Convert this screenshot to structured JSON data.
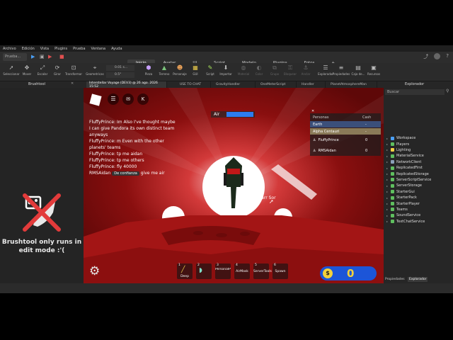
{
  "menu": [
    "Archivo",
    "Edición",
    "Vista",
    "Plugins",
    "Prueba",
    "Ventana",
    "Ayuda"
  ],
  "place_selector": "Prueba...",
  "ribbon_tabs": [
    {
      "label": "Inicio",
      "active": true
    },
    {
      "label": "Avatar",
      "active": false
    },
    {
      "label": "UI",
      "active": false
    },
    {
      "label": "Script",
      "active": false
    },
    {
      "label": "Modelo",
      "active": false
    },
    {
      "label": "Plugins",
      "active": false
    },
    {
      "label": "Fotos",
      "active": false
    },
    {
      "label": "+",
      "active": false
    }
  ],
  "tools": [
    {
      "label": "Seleccionar",
      "icon": "cursor-icon"
    },
    {
      "label": "Mover",
      "icon": "move-icon"
    },
    {
      "label": "Escalar",
      "icon": "scale-icon"
    },
    {
      "label": "Girar",
      "icon": "rotate-icon"
    },
    {
      "label": "Transformar",
      "icon": "transform-icon"
    },
    {
      "label": "Geometricas",
      "icon": "geometry-icon"
    },
    {
      "label": "Pieza",
      "icon": "part-icon"
    },
    {
      "label": "Terreno",
      "icon": "terrain-icon"
    },
    {
      "label": "Personaje",
      "icon": "character-icon"
    },
    {
      "label": "GUI",
      "icon": "gui-icon"
    },
    {
      "label": "Script",
      "icon": "script-icon"
    },
    {
      "label": "Importar",
      "icon": "import-icon"
    },
    {
      "label": "Material",
      "icon": "material-icon"
    },
    {
      "label": "Color",
      "icon": "color-icon"
    },
    {
      "label": "Grupo",
      "icon": "group-icon"
    },
    {
      "label": "Bloquear",
      "icon": "lock-icon"
    },
    {
      "label": "Anclar",
      "icon": "anchor-icon"
    },
    {
      "label": "Explorador",
      "icon": "explorer-icon"
    },
    {
      "label": "Propiedades",
      "icon": "properties-icon"
    },
    {
      "label": "Caja de...",
      "icon": "toolbox-icon"
    },
    {
      "label": "Recursos",
      "icon": "assets-icon"
    }
  ],
  "stud_values": [
    "0.01 s...",
    "0.5°"
  ],
  "panels": {
    "left_title": "Brushtool",
    "right_title": "Explorador",
    "explorer_search": "Buscar",
    "props_tab": "Propiedades",
    "explorer_tab": "Explorador"
  },
  "doc_tabs": [
    {
      "label": "Interstellar Voyage (DEV3) @ 26 ago. 2026 15:52",
      "active": true
    },
    {
      "label": "USE TO CHAT",
      "active": false
    },
    {
      "label": "GravityHandler",
      "active": false
    },
    {
      "label": "OneMeterScript",
      "active": false
    },
    {
      "label": "Handler",
      "active": false
    },
    {
      "label": "PlanetAtmosphereMan",
      "active": false
    }
  ],
  "brushtool": {
    "message": "Brushtool only runs in edit mode :'("
  },
  "explorer_items": [
    {
      "label": "Workspace",
      "color": "#4a9ff5"
    },
    {
      "label": "Players",
      "color": "#5fbf5f"
    },
    {
      "label": "Lighting",
      "color": "#f5d142"
    },
    {
      "label": "MaterialService",
      "color": "#5fbf5f"
    },
    {
      "label": "NetworkClient",
      "color": "#8aa0b8"
    },
    {
      "label": "ReplicatedFirst",
      "color": "#5fbf5f"
    },
    {
      "label": "ReplicatedStorage",
      "color": "#5fbf5f"
    },
    {
      "label": "ServerScriptService",
      "color": "#5fbf5f"
    },
    {
      "label": "ServerStorage",
      "color": "#5fbf5f"
    },
    {
      "label": "StarterGui",
      "color": "#5fbf5f"
    },
    {
      "label": "StarterPack",
      "color": "#5fbf5f"
    },
    {
      "label": "StarterPlayer",
      "color": "#5fbf5f"
    },
    {
      "label": "Teams",
      "color": "#5fbf5f"
    },
    {
      "label": "SoundService",
      "color": "#5fbf5f"
    },
    {
      "label": "TextChatService",
      "color": "#5fbf5f"
    }
  ],
  "game": {
    "chat": [
      {
        "user": "FluffyPrince:",
        "text": " Im Also I've thought maybe"
      },
      {
        "user": "",
        "text": "I can give Pandora its own distinct team"
      },
      {
        "user": "",
        "text": "anyways"
      },
      {
        "user": "FluffyPrince:",
        "text": " m Even with the other"
      },
      {
        "user": "",
        "text": "planets' teams"
      },
      {
        "user": "FluffyPrince:",
        "text": " tp me aidan"
      },
      {
        "user": "FluffyPrince:",
        "text": " tp me others"
      },
      {
        "user": "FluffyPrince:",
        "text": " fly 40000"
      },
      {
        "user": "RMSAidan",
        "tag": "De confianza",
        "text": " give me air"
      }
    ],
    "air_label": "Air",
    "air_level": 1.0,
    "leaderboard": {
      "headers": [
        "Personas",
        "Cash"
      ],
      "rows": [
        {
          "name": "Earth",
          "value": "-",
          "team_color": "#3b4f7a"
        },
        {
          "name": "Alpha Centauri",
          "value": "-",
          "team_color": "#8a7a58"
        },
        {
          "name": "FluffyPrince",
          "value": "0"
        },
        {
          "name": "RMSAidan",
          "value": "0"
        }
      ]
    },
    "nametag": "Nearr Sor",
    "cash": "0",
    "hotbar": [
      {
        "num": "1",
        "label": "Deep"
      },
      {
        "num": "2",
        "label": ""
      },
      {
        "num": "3",
        "label": "PersonalPla"
      },
      {
        "num": "4",
        "label": "AirMask"
      },
      {
        "num": "5",
        "label": "ServerTools"
      },
      {
        "num": "6",
        "label": "Spawn"
      }
    ],
    "colors": {
      "sky": "#7a0d0d",
      "ground": "#a11414",
      "sun": "#ffffff",
      "cash_bar": "#1c55d8"
    }
  }
}
